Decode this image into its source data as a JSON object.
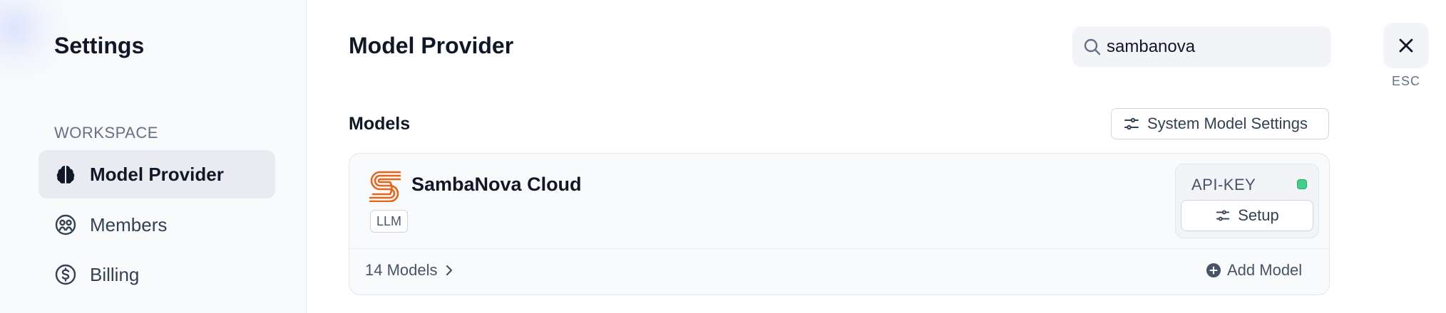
{
  "sidebar": {
    "title": "Settings",
    "section_label": "WORKSPACE",
    "items": [
      {
        "label": "Model Provider",
        "icon": "brain-icon",
        "active": true
      },
      {
        "label": "Members",
        "icon": "members-icon",
        "active": false
      },
      {
        "label": "Billing",
        "icon": "billing-icon",
        "active": false
      }
    ]
  },
  "main": {
    "title": "Model Provider",
    "search": {
      "value": "sambanova",
      "icon": "search-icon"
    },
    "close": {
      "label": "ESC",
      "icon": "close-icon"
    },
    "models_label": "Models",
    "system_settings_label": "System Model Settings",
    "provider": {
      "name": "SambaNova Cloud",
      "badge": "LLM",
      "logo": "sambanova-logo",
      "auth_label": "API-KEY",
      "status_color": "#47cd89",
      "setup_label": "Setup",
      "models_count": "14 Models",
      "add_model_label": "Add Model"
    }
  },
  "colors": {
    "accent_orange": "#e5661b",
    "status_green": "#47cd89"
  }
}
